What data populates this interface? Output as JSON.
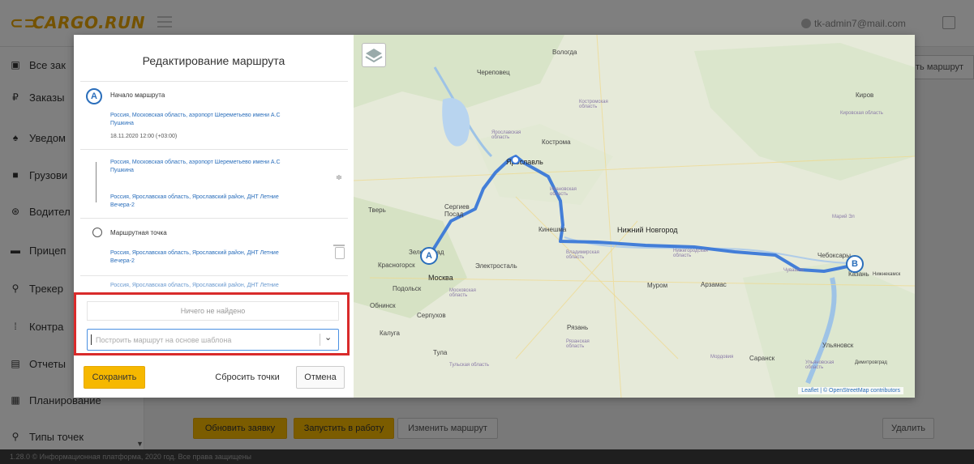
{
  "app": {
    "logo": "CARGO.RUN",
    "user_email": "tk-admin7@mail.com"
  },
  "sidebar": {
    "items": [
      {
        "label": "Все зак",
        "icon": "doc-icon"
      },
      {
        "label": "Заказы",
        "icon": "ruble-icon"
      },
      {
        "label": "Уведом",
        "icon": "bell-icon"
      },
      {
        "label": "Грузови",
        "icon": "truck-icon"
      },
      {
        "label": "Водител",
        "icon": "steering-icon"
      },
      {
        "label": "Прицеп",
        "icon": "trailer-icon"
      },
      {
        "label": "Трекер",
        "icon": "pin-icon"
      },
      {
        "label": "Контра",
        "icon": "contract-icon"
      },
      {
        "label": "Отчеты",
        "icon": "report-icon"
      },
      {
        "label": "Планирование",
        "icon": "calendar-icon"
      },
      {
        "label": "Типы точек",
        "icon": "pin-icon"
      }
    ]
  },
  "page": {
    "right_top_button": "ть маршрут",
    "update_button": "Обновить заявку",
    "start_button": "Запустить в работу",
    "change_route_button": "Изменить маршрут",
    "delete_button": "Удалить",
    "footer_text": "1.28.0 © Информационная платформа, 2020 год. Все права защищены"
  },
  "modal": {
    "title": "Редактирование маршрута",
    "start_point": {
      "marker": "A",
      "title": "Начало маршрута",
      "address_line1": "Россия, Московская область, аэропорт Шереметьево имени А.С",
      "address_line2": "Пушкина",
      "date": "18.11.2020 12:00 (+03:00)"
    },
    "segment": {
      "from_line1": "Россия, Московская область, аэропорт Шереметьево имени А.С",
      "from_line2": "Пушкина",
      "to_line1": "Россия, Ярославская область, Ярославский район, ДНТ Летние",
      "to_line2": "Вечера-2"
    },
    "waypoint": {
      "title": "Маршрутная точка",
      "address_line1": "Россия, Ярославская область, Ярославский район, ДНТ Летние",
      "address_line2": "Вечера-2"
    },
    "cut_line": "Россия, Ярославская область, Ярославский район, ДНТ Летние",
    "not_found": "Ничего не найдено",
    "template_placeholder": "Построить маршрут на основе шаблона",
    "save_button": "Сохранить",
    "reset_button": "Сбросить точки",
    "cancel_button": "Отмена"
  },
  "map": {
    "marker_a": "A",
    "marker_b": "B",
    "cities": [
      "Вологда",
      "Череповец",
      "Кострома",
      "Ярославль",
      "Тверь",
      "Сергиев Посад",
      "Кинешма",
      "Нижний Новгород",
      "Чебоксары",
      "Казань",
      "Москва",
      "Красногорск",
      "Подольск",
      "Электросталь",
      "Муром",
      "Арзамас",
      "Обнинск",
      "Серпухов",
      "Рязань",
      "Калуга",
      "Тула",
      "Ульяновск",
      "Саранск",
      "Киров",
      "Зеленоград",
      "Нижнекамск",
      "Димитровград"
    ],
    "regions": [
      "Костромская область",
      "Кировская область",
      "Ярославская область",
      "Ивановская область",
      "Владимирская область",
      "Нижегородская область",
      "Московская область",
      "Рязанская область",
      "Тульская область",
      "Мордовия",
      "Ульяновская область",
      "Чувашия",
      "Марий Эл"
    ],
    "attribution": "Leaflet | © OpenStreetMap contributors",
    "route_color": "#3a78d8"
  }
}
